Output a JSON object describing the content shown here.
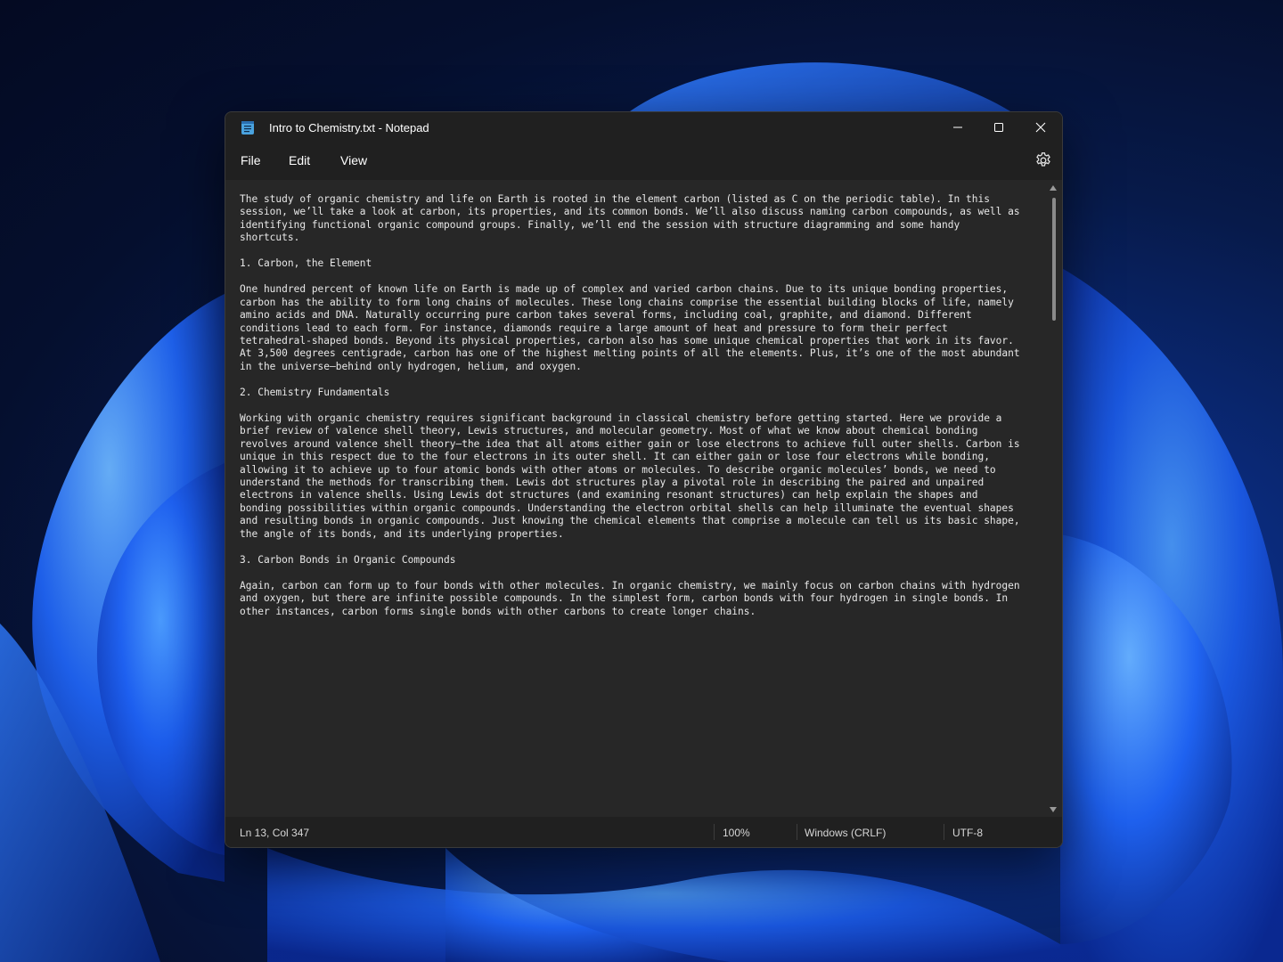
{
  "window": {
    "title": "Intro to Chemistry.txt - Notepad",
    "app_icon": "notepad-icon",
    "controls": [
      "minimize-icon",
      "maximize-icon",
      "close-icon"
    ]
  },
  "menu": {
    "items": [
      "File",
      "Edit",
      "View"
    ],
    "settings_icon": "gear-icon"
  },
  "editor": {
    "text": "The study of organic chemistry and life on Earth is rooted in the element carbon (listed as C on the periodic table). In this\nsession, we’ll take a look at carbon, its properties, and its common bonds. We’ll also discuss naming carbon compounds, as well as\nidentifying functional organic compound groups. Finally, we’ll end the session with structure diagramming and some handy\nshortcuts.\n\n1. Carbon, the Element\n\nOne hundred percent of known life on Earth is made up of complex and varied carbon chains. Due to its unique bonding properties,\ncarbon has the ability to form long chains of molecules. These long chains comprise the essential building blocks of life, namely\namino acids and DNA. Naturally occurring pure carbon takes several forms, including coal, graphite, and diamond. Different\nconditions lead to each form. For instance, diamonds require a large amount of heat and pressure to form their perfect\ntetrahedral-shaped bonds. Beyond its physical properties, carbon also has some unique chemical properties that work in its favor.\nAt 3,500 degrees centigrade, carbon has one of the highest melting points of all the elements. Plus, it’s one of the most abundant\nin the universe—behind only hydrogen, helium, and oxygen.\n\n2. Chemistry Fundamentals\n\nWorking with organic chemistry requires significant background in classical chemistry before getting started. Here we provide a\nbrief review of valence shell theory, Lewis structures, and molecular geometry. Most of what we know about chemical bonding\nrevolves around valence shell theory—the idea that all atoms either gain or lose electrons to achieve full outer shells. Carbon is\nunique in this respect due to the four electrons in its outer shell. It can either gain or lose four electrons while bonding,\nallowing it to achieve up to four atomic bonds with other atoms or molecules. To describe organic molecules’ bonds, we need to\nunderstand the methods for transcribing them. Lewis dot structures play a pivotal role in describing the paired and unpaired\nelectrons in valence shells. Using Lewis dot structures (and examining resonant structures) can help explain the shapes and\nbonding possibilities within organic compounds. Understanding the electron orbital shells can help illuminate the eventual shapes\nand resulting bonds in organic compounds. Just knowing the chemical elements that comprise a molecule can tell us its basic shape,\nthe angle of its bonds, and its underlying properties.\n\n3. Carbon Bonds in Organic Compounds\n\nAgain, carbon can form up to four bonds with other molecules. In organic chemistry, we mainly focus on carbon chains with hydrogen\nand oxygen, but there are infinite possible compounds. In the simplest form, carbon bonds with four hydrogen in single bonds. In\nother instances, carbon forms single bonds with other carbons to create longer chains."
  },
  "status": {
    "position": "Ln 13, Col 347",
    "zoom": "100%",
    "line_ending": "Windows (CRLF)",
    "encoding": "UTF-8"
  }
}
